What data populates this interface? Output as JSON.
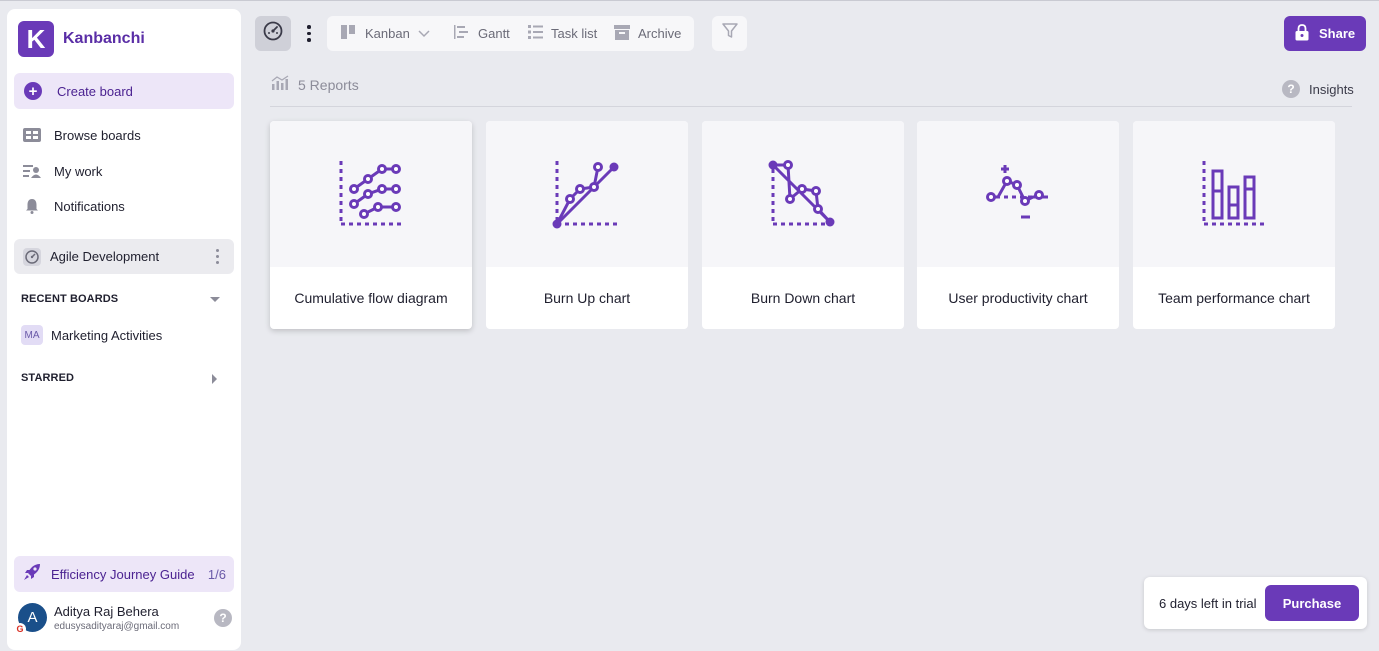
{
  "brand": {
    "name": "Kanbanchi",
    "logo_letter": "K"
  },
  "sidebar": {
    "create_board": "Create board",
    "nav": [
      {
        "label": "Browse boards",
        "icon": "browse-boards-icon"
      },
      {
        "label": "My work",
        "icon": "my-work-icon"
      },
      {
        "label": "Notifications",
        "icon": "bell-icon"
      }
    ],
    "current_board": "Agile Development",
    "recent_boards_heading": "RECENT BOARDS",
    "recent_boards": [
      {
        "initials": "MA",
        "label": "Marketing Activities"
      }
    ],
    "starred_heading": "STARRED",
    "guide": {
      "label": "Efficiency Journey Guide",
      "progress": "1/6"
    },
    "user": {
      "initial": "A",
      "name": "Aditya Raj Behera",
      "email": "edusysadityaraj@gmail.com",
      "provider_badge": "G"
    }
  },
  "toolbar": {
    "views": [
      {
        "label": "Kanban",
        "icon": "kanban-icon"
      },
      {
        "label": "Gantt",
        "icon": "gantt-icon"
      },
      {
        "label": "Task list",
        "icon": "task-list-icon"
      },
      {
        "label": "Archive",
        "icon": "archive-icon"
      }
    ],
    "share_label": "Share"
  },
  "reports": {
    "count_label": "5 Reports",
    "insights_label": "Insights",
    "cards": [
      {
        "label": "Cumulative flow diagram",
        "icon": "cumulative-flow-icon"
      },
      {
        "label": "Burn Up chart",
        "icon": "burn-up-icon"
      },
      {
        "label": "Burn Down chart",
        "icon": "burn-down-icon"
      },
      {
        "label": "User productivity chart",
        "icon": "user-productivity-icon"
      },
      {
        "label": "Team performance chart",
        "icon": "team-performance-icon"
      }
    ]
  },
  "trial": {
    "text": "6 days left in trial",
    "purchase_label": "Purchase"
  },
  "colors": {
    "accent": "#6a3ab8",
    "accent_light": "#ede6f8",
    "background": "#e9eaef"
  }
}
